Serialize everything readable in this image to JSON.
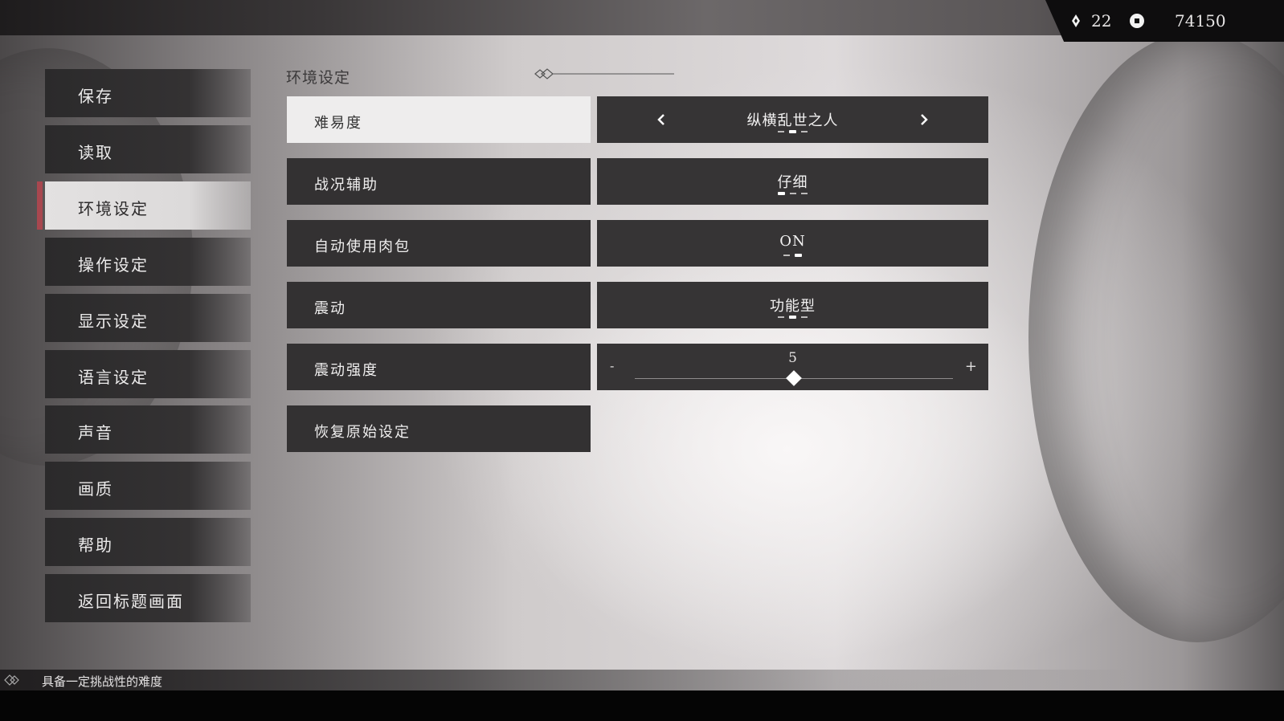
{
  "currency": {
    "gems": "22",
    "coins": "74150"
  },
  "menu": {
    "items": [
      {
        "label": "保存"
      },
      {
        "label": "读取"
      },
      {
        "label": "环境设定"
      },
      {
        "label": "操作设定"
      },
      {
        "label": "显示设定"
      },
      {
        "label": "语言设定"
      },
      {
        "label": "声音"
      },
      {
        "label": "画质"
      },
      {
        "label": "帮助"
      },
      {
        "label": "返回标题画面"
      }
    ],
    "active_index": 2
  },
  "section": {
    "title": "环境设定"
  },
  "settings": [
    {
      "label": "难易度",
      "value": "纵横乱世之人",
      "option_count": 3,
      "selected_option": 2
    },
    {
      "label": "战况辅助",
      "value": "仔细",
      "option_count": 3,
      "selected_option": 1
    },
    {
      "label": "自动使用肉包",
      "value": "ON",
      "option_count": 2,
      "selected_option": 2
    },
    {
      "label": "震动",
      "value": "功能型",
      "option_count": 3,
      "selected_option": 2
    },
    {
      "label": "震动强度",
      "value": "5",
      "min_symbol": "-",
      "max_symbol": "+",
      "slider_fraction": 0.5
    },
    {
      "label": "恢复原始设定"
    }
  ],
  "hint": {
    "text": "具备一定挑战性的难度"
  },
  "colors": {
    "active_marker": "#a8474f",
    "panel_dark": "#333132",
    "panel_light": "#eeeded"
  }
}
